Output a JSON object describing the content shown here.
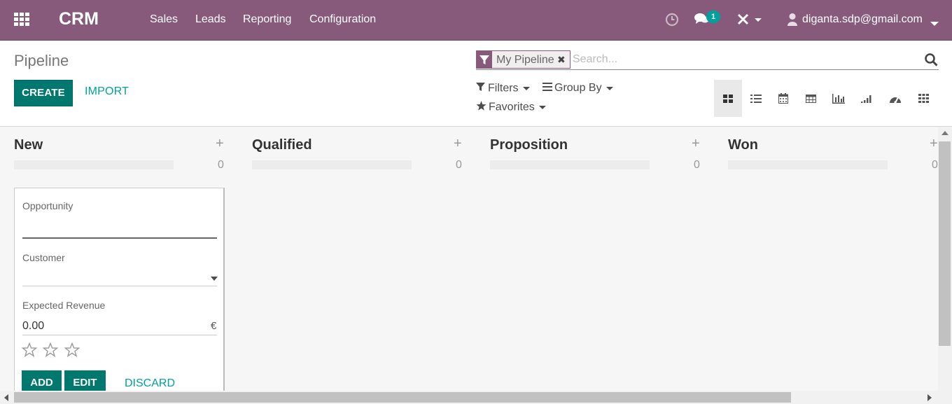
{
  "navbar": {
    "brand": "CRM",
    "menu": [
      "Sales",
      "Leads",
      "Reporting",
      "Configuration"
    ],
    "messages_count": "1",
    "user": "diganta.sdp@gmail.com",
    "background": "#875a7b"
  },
  "control_panel": {
    "breadcrumb": "Pipeline",
    "create_label": "CREATE",
    "import_label": "IMPORT",
    "search": {
      "facet": "My Pipeline",
      "placeholder": "Search..."
    },
    "filters_label": "Filters",
    "group_by_label": "Group By",
    "favorites_label": "Favorites",
    "views": [
      "kanban",
      "list",
      "calendar",
      "pivot",
      "graph",
      "cohort",
      "dashboard",
      "activity"
    ],
    "active_view": "kanban"
  },
  "kanban": {
    "columns": [
      {
        "title": "New",
        "count": "0"
      },
      {
        "title": "Qualified",
        "count": "0"
      },
      {
        "title": "Proposition",
        "count": "0"
      },
      {
        "title": "Won",
        "count": "0"
      }
    ],
    "quick_create": {
      "opportunity_label": "Opportunity",
      "opportunity_value": "",
      "customer_label": "Customer",
      "customer_value": "",
      "revenue_label": "Expected Revenue",
      "revenue_value": "0.00",
      "currency": "€",
      "priority_stars": 0,
      "add_label": "ADD",
      "edit_label": "EDIT",
      "discard_label": "DISCARD"
    }
  },
  "colors": {
    "primary": "#00786d",
    "link": "#00a09d",
    "badge": "#00a09d"
  }
}
